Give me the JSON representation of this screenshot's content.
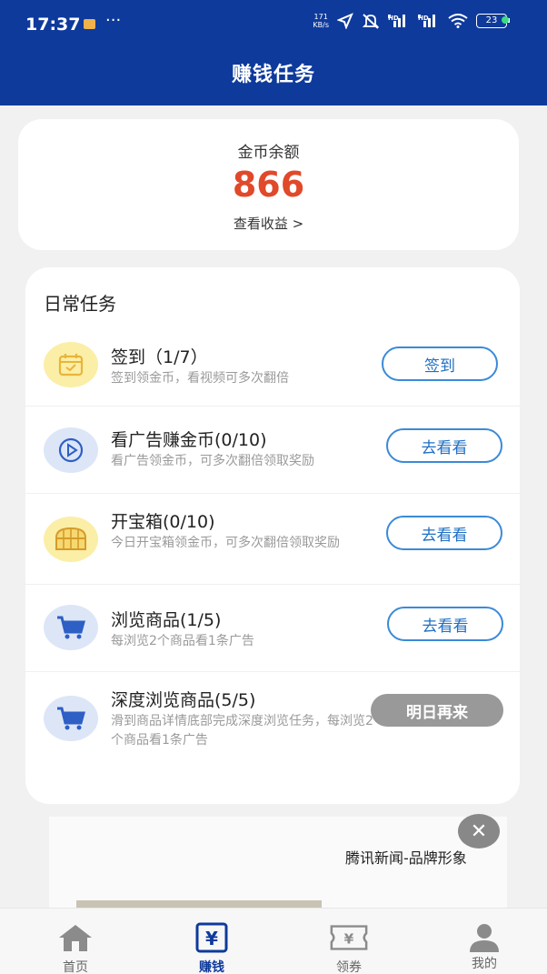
{
  "status_bar": {
    "time": "17:37",
    "more": "···",
    "net_speed_value": "171",
    "net_speed_unit": "KB/s",
    "hd1": "HD",
    "hd2": "HD",
    "battery": "23"
  },
  "header": {
    "title": "赚钱任务"
  },
  "balance": {
    "label": "金币余额",
    "value": "866",
    "link": "查看收益 >"
  },
  "tasks": {
    "title": "日常任务",
    "items": [
      {
        "title": "签到（1/7）",
        "desc": "签到领金币，看视频可多次翻倍",
        "button": "签到",
        "icon": "calendar-icon"
      },
      {
        "title": "看广告赚金币(0/10)",
        "desc": "看广告领金币，可多次翻倍领取奖励",
        "button": "去看看",
        "icon": "play-icon"
      },
      {
        "title": "开宝箱(0/10)",
        "desc": "今日开宝箱领金币，可多次翻倍领取奖励",
        "button": "去看看",
        "icon": "treasure-chest-icon"
      },
      {
        "title": "浏览商品(1/5)",
        "desc": "每浏览2个商品看1条广告",
        "button": "去看看",
        "icon": "cart-icon"
      },
      {
        "title": "深度浏览商品(5/5)",
        "desc": "滑到商品详情底部完成深度浏览任务，每浏览2个商品看1条广告",
        "button": "明日再来",
        "icon": "cart-icon"
      }
    ]
  },
  "ad": {
    "title": "腾讯新闻-品牌形象",
    "close": "✕"
  },
  "nav": {
    "items": [
      {
        "label": "首页",
        "icon": "home-icon"
      },
      {
        "label": "赚钱",
        "icon": "yen-icon"
      },
      {
        "label": "领券",
        "icon": "coupon-icon"
      },
      {
        "label": "我的",
        "icon": "profile-icon"
      }
    ],
    "active": "赚钱"
  },
  "colors": {
    "header": "#0e3a9c",
    "balance_value": "#e0492a",
    "button_border": "#3b8ad8",
    "disabled_button": "#999999",
    "icon_yellow": "#fbeea6",
    "icon_blue": "#dde6f7"
  }
}
